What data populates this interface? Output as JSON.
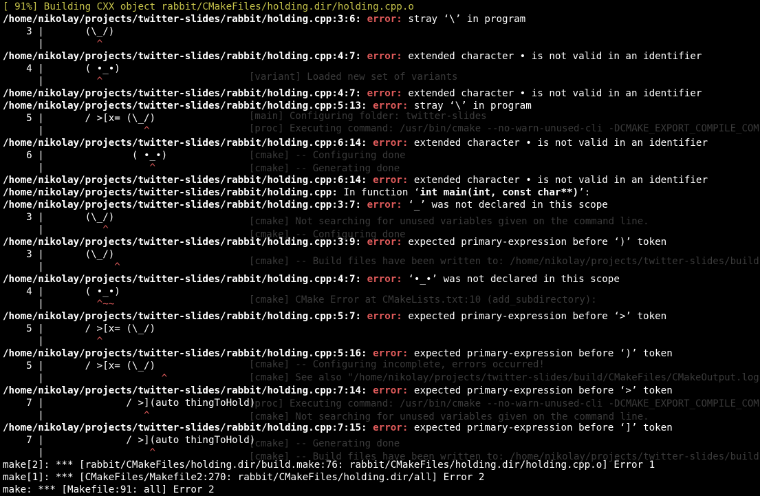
{
  "terminal": {
    "status_line": "[ 91%] Building CXX object rabbit/CMakeFiles/holding.dir/holding.cpp.o",
    "lines": [
      {
        "type": "diag",
        "loc": "/home/nikolay/projects/twitter-slides/rabbit/holding.cpp:3:6:",
        "label": "error:",
        "msg": " stray ‘\\’ in program"
      },
      {
        "type": "code",
        "num": "    3 |",
        "code": "       (\\_/)"
      },
      {
        "type": "caret",
        "text": "      |         ^"
      },
      {
        "type": "diag",
        "loc": "/home/nikolay/projects/twitter-slides/rabbit/holding.cpp:4:7:",
        "label": "error:",
        "msg": " extended character • is not valid in an identifier"
      },
      {
        "type": "code",
        "num": "    4 |",
        "code": "       ( •_•)"
      },
      {
        "type": "caret",
        "text": "      |         ^"
      },
      {
        "type": "diag",
        "loc": "/home/nikolay/projects/twitter-slides/rabbit/holding.cpp:4:7:",
        "label": "error:",
        "msg": " extended character • is not valid in an identifier"
      },
      {
        "type": "diag",
        "loc": "/home/nikolay/projects/twitter-slides/rabbit/holding.cpp:5:13:",
        "label": "error:",
        "msg": " stray ‘\\’ in program"
      },
      {
        "type": "code",
        "num": "    5 |",
        "code": "       / >[x= (\\_/)"
      },
      {
        "type": "caret",
        "text": "      |                 ^"
      },
      {
        "type": "diag",
        "loc": "/home/nikolay/projects/twitter-slides/rabbit/holding.cpp:6:14:",
        "label": "error:",
        "msg": " extended character • is not valid in an identifier"
      },
      {
        "type": "code",
        "num": "    6 |",
        "code": "               ( •_•)"
      },
      {
        "type": "caret",
        "text": "      |                  ^"
      },
      {
        "type": "diag",
        "loc": "/home/nikolay/projects/twitter-slides/rabbit/holding.cpp:6:14:",
        "label": "error:",
        "msg": " extended character • is not valid in an identifier"
      },
      {
        "type": "func",
        "loc": "/home/nikolay/projects/twitter-slides/rabbit/holding.cpp:",
        "msg": " In function ‘",
        "fn": "int main(int, const char**)",
        "end": "’:"
      },
      {
        "type": "diag",
        "loc": "/home/nikolay/projects/twitter-slides/rabbit/holding.cpp:3:7:",
        "label": "error:",
        "msg": " ‘_’ was not declared in this scope"
      },
      {
        "type": "code",
        "num": "    3 |",
        "code": "       (\\_/)"
      },
      {
        "type": "caret",
        "text": "      |          ^"
      },
      {
        "type": "diag",
        "loc": "/home/nikolay/projects/twitter-slides/rabbit/holding.cpp:3:9:",
        "label": "error:",
        "msg": " expected primary-expression before ‘)’ token"
      },
      {
        "type": "code",
        "num": "    3 |",
        "code": "       (\\_/)"
      },
      {
        "type": "caret",
        "text": "      |            ^"
      },
      {
        "type": "diag",
        "loc": "/home/nikolay/projects/twitter-slides/rabbit/holding.cpp:4:7:",
        "label": "error:",
        "msg": " ‘•_•’ was not declared in this scope"
      },
      {
        "type": "code",
        "num": "    4 |",
        "code": "       ( •_•)"
      },
      {
        "type": "caret",
        "text": "      |         ^~~"
      },
      {
        "type": "diag",
        "loc": "/home/nikolay/projects/twitter-slides/rabbit/holding.cpp:5:7:",
        "label": "error:",
        "msg": " expected primary-expression before ‘>’ token"
      },
      {
        "type": "code",
        "num": "    5 |",
        "code": "       / >[x= (\\_/)"
      },
      {
        "type": "caret",
        "text": "      |         ^"
      },
      {
        "type": "diag",
        "loc": "/home/nikolay/projects/twitter-slides/rabbit/holding.cpp:5:16:",
        "label": "error:",
        "msg": " expected primary-expression before ‘)’ token"
      },
      {
        "type": "code",
        "num": "    5 |",
        "code": "       / >[x= (\\_/)"
      },
      {
        "type": "caret",
        "text": "      |                    ^"
      },
      {
        "type": "diag",
        "loc": "/home/nikolay/projects/twitter-slides/rabbit/holding.cpp:7:14:",
        "label": "error:",
        "msg": " expected primary-expression before ‘>’ token"
      },
      {
        "type": "code",
        "num": "    7 |",
        "code": "              / >](auto thingToHold)"
      },
      {
        "type": "caret",
        "text": "      |                 ^"
      },
      {
        "type": "diag",
        "loc": "/home/nikolay/projects/twitter-slides/rabbit/holding.cpp:7:15:",
        "label": "error:",
        "msg": " expected primary-expression before ‘]’ token"
      },
      {
        "type": "code",
        "num": "    7 |",
        "code": "              / >](auto thingToHold)"
      },
      {
        "type": "caret",
        "text": "      |                  ^"
      },
      {
        "type": "plain",
        "text": "make[2]: *** [rabbit/CMakeFiles/holding.dir/build.make:76: rabbit/CMakeFiles/holding.dir/holding.cpp.o] Error 1"
      },
      {
        "type": "plain",
        "text": "make[1]: *** [CMakeFiles/Makefile2:270: rabbit/CMakeFiles/holding.dir/all] Error 2"
      },
      {
        "type": "plain",
        "text": "make: *** [Makefile:91: all] Error 2"
      }
    ]
  },
  "background": {
    "lines": [
      "[variant] Loaded new set of variants",
      "[main] Configuring folder: twitter-slides",
      "[proc] Executing command: /usr/bin/cmake --no-warn-unused-cli -DCMAKE_EXPORT_COMPILE_COM",
      "[cmake] -- Configuring done",
      "[cmake] -- Generating done",
      "[cmake] Not searching for unused variables given on the command line.",
      "[cmake] -- Configuring done",
      "[cmake] -- Build files have been written to: /home/nikolay/projects/twitter-slides/build",
      "[cmake] CMake Error at CMakeLists.txt:10 (add_subdirectory):",
      "[cmake] -- Configuring incomplete, errors occurred!",
      "[cmake] See also \"/home/nikolay/projects/twitter-slides/build/CMakeFiles/CMakeOutput.log",
      "[proc] Executing command: /usr/bin/cmake --no-warn-unused-cli -DCMAKE_EXPORT_COMPILE_COM",
      "[cmake] Not searching for unused variables given on the command line.",
      "[cmake] -- Generating done",
      "[cmake] -- Build files have been written to: /home/nikolay/projects/twitter-slides/build"
    ]
  },
  "colors": {
    "background": "#000000",
    "foreground": "#ffffff",
    "error": "#e05b5b",
    "status": "#c4c14a"
  }
}
